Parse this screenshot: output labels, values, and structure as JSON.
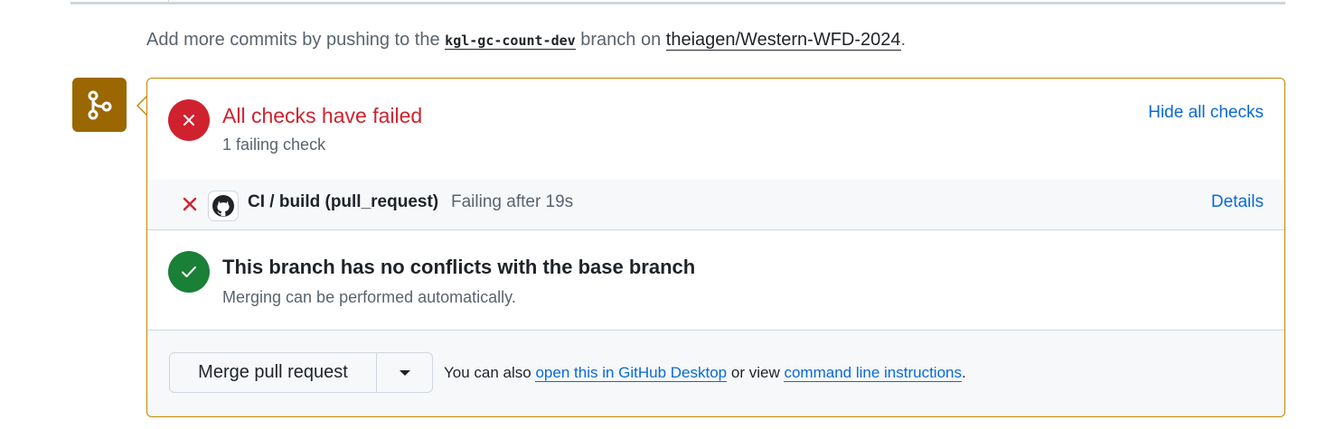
{
  "push_note": {
    "prefix": "Add more commits by pushing to the",
    "branch": "kgl-gc-count-dev",
    "middle": "branch on",
    "repo": "theiagen/Western-WFD-2024",
    "suffix": "."
  },
  "checks": {
    "title": "All checks have failed",
    "subtitle": "1 failing check",
    "hide_label": "Hide all checks",
    "items": [
      {
        "name": "CI / build (pull_request)",
        "status": "Failing after 19s",
        "details_label": "Details"
      }
    ]
  },
  "conflicts": {
    "title": "This branch has no conflicts with the base branch",
    "subtitle": "Merging can be performed automatically."
  },
  "merge": {
    "button_label": "Merge pull request",
    "note_prefix": "You can also",
    "desktop_link": "open this in GitHub Desktop",
    "note_middle": "or view",
    "cli_link": "command line instructions",
    "note_suffix": "."
  },
  "icons": {
    "merge_box": "git-merge-icon",
    "fail": "x-circle-icon",
    "ok": "check-circle-icon",
    "item_fail": "x-icon",
    "app": "github-logo-icon",
    "dropdown": "triangle-down-icon"
  },
  "colors": {
    "fail": "#cf222e",
    "success": "#1a7f37",
    "attention": "#9a6700",
    "link": "#0969da"
  }
}
